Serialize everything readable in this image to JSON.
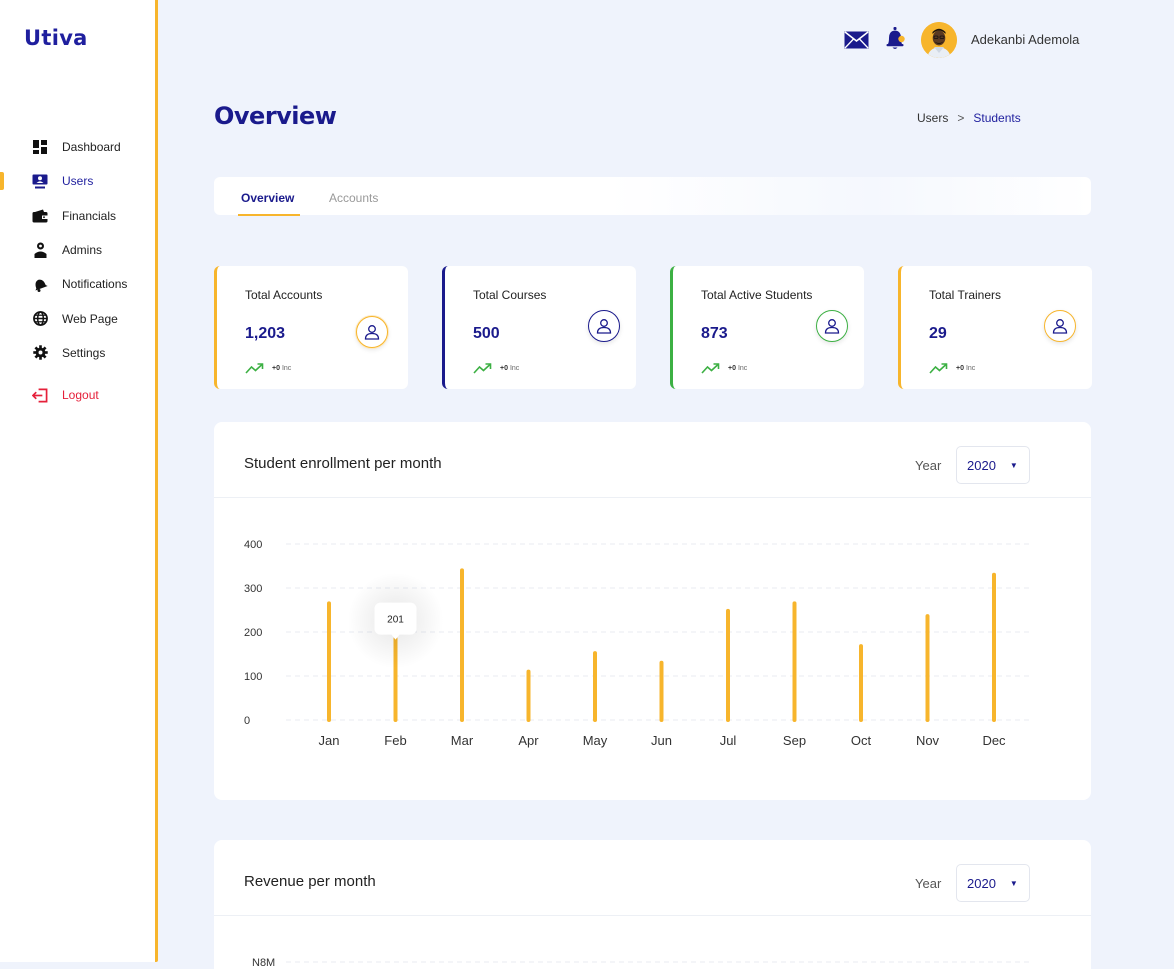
{
  "app": {
    "logo": "Utiva"
  },
  "sidebar": {
    "items": [
      {
        "label": "Dashboard",
        "icon": "dashboard-grid-icon"
      },
      {
        "label": "Users",
        "icon": "users-monitor-icon",
        "active": true
      },
      {
        "label": "Financials",
        "icon": "wallet-icon"
      },
      {
        "label": "Admins",
        "icon": "admin-person-icon"
      },
      {
        "label": "Notifications",
        "icon": "notification-bell-icon"
      },
      {
        "label": "Web Page",
        "icon": "globe-icon"
      },
      {
        "label": "Settings",
        "icon": "gear-icon"
      }
    ],
    "logout": {
      "label": "Logout",
      "icon": "logout-icon"
    }
  },
  "header": {
    "user_name": "Adekanbi Ademola"
  },
  "page": {
    "title": "Overview",
    "breadcrumb": {
      "parent": "Users",
      "separator": ">",
      "current": "Students"
    }
  },
  "tabs": [
    {
      "label": "Overview",
      "active": true
    },
    {
      "label": "Accounts"
    }
  ],
  "stats": [
    {
      "title": "Total Accounts",
      "value": "1,203",
      "trend_value": "+0",
      "trend_unit": "Inc",
      "accent": "#f7b52c"
    },
    {
      "title": "Total Courses",
      "value": "500",
      "trend_value": "+0",
      "trend_unit": "Inc",
      "accent": "#1a1a8c"
    },
    {
      "title": "Total Active Students",
      "value": "873",
      "trend_value": "+0",
      "trend_unit": "Inc",
      "accent": "#3cb043"
    },
    {
      "title": "Total Trainers",
      "value": "29",
      "trend_value": "+0",
      "trend_unit": "Inc",
      "accent": "#f7b52c"
    }
  ],
  "enrollment_panel": {
    "title": "Student enrollment per month",
    "year_label": "Year",
    "year_value": "2020"
  },
  "revenue_panel": {
    "title": "Revenue per month",
    "year_label": "Year",
    "year_value": "2020"
  },
  "chart_data": [
    {
      "type": "bar",
      "title": "Student enrollment per month",
      "categories": [
        "Jan",
        "Feb",
        "Mar",
        "Apr",
        "May",
        "Jun",
        "Jul",
        "Sep",
        "Oct",
        "Nov",
        "Dec"
      ],
      "values": [
        265,
        185,
        340,
        110,
        152,
        130,
        248,
        265,
        168,
        236,
        330
      ],
      "ylim": [
        0,
        400
      ],
      "yticks": [
        "0",
        "100",
        "200",
        "300",
        "400"
      ],
      "tooltip": {
        "category": "Feb",
        "label": "201"
      },
      "bar_color": "#f7b52c",
      "grid": true
    },
    {
      "type": "bar",
      "title": "Revenue per month",
      "yticks": [
        "N8M"
      ]
    }
  ]
}
